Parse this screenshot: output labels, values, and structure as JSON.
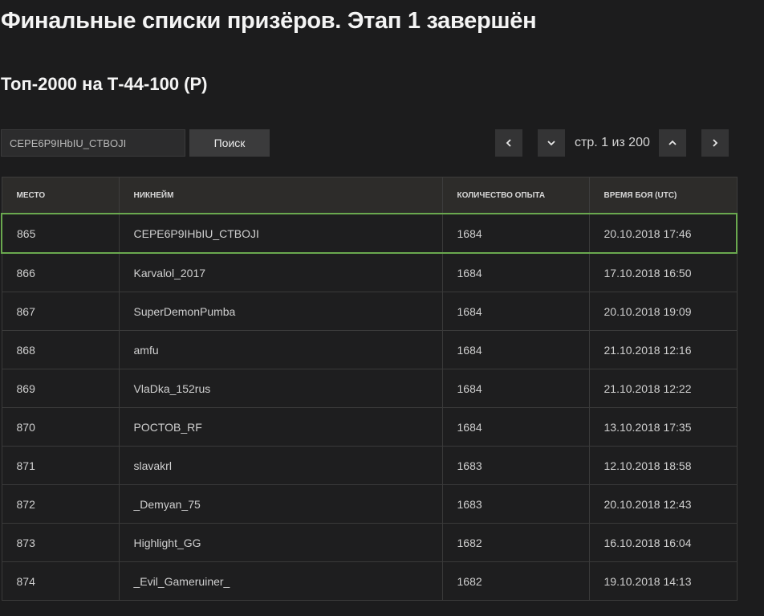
{
  "page": {
    "title": "Финальные списки призёров. Этап 1 завершён",
    "subtitle": "Топ-2000 на Т-44-100 (Р)"
  },
  "search": {
    "value": "CEPE6P9IHbIU_CTBOJI",
    "button_label": "Поиск"
  },
  "pagination": {
    "info": "стр. 1 из 200",
    "icons": [
      "chevron-left-icon",
      "chevron-down-icon",
      "chevron-up-icon",
      "chevron-right-icon"
    ]
  },
  "table": {
    "columns": [
      "Место",
      "Никнейм",
      "Количество опыта",
      "Время боя (UTC)"
    ],
    "highlight_color": "#6aa84f",
    "rows": [
      {
        "place": "865",
        "nickname": "CEPE6P9IHbIU_CTBOJI",
        "xp": "1684",
        "time": "20.10.2018 17:46"
      },
      {
        "place": "866",
        "nickname": "Karvalol_2017",
        "xp": "1684",
        "time": "17.10.2018 16:50"
      },
      {
        "place": "867",
        "nickname": "SuperDemonPumba",
        "xp": "1684",
        "time": "20.10.2018 19:09"
      },
      {
        "place": "868",
        "nickname": "amfu",
        "xp": "1684",
        "time": "21.10.2018 12:16"
      },
      {
        "place": "869",
        "nickname": "VlaDka_152rus",
        "xp": "1684",
        "time": "21.10.2018 12:22"
      },
      {
        "place": "870",
        "nickname": "POCTOB_RF",
        "xp": "1684",
        "time": "13.10.2018 17:35"
      },
      {
        "place": "871",
        "nickname": "slavakrl",
        "xp": "1683",
        "time": "12.10.2018 18:58"
      },
      {
        "place": "872",
        "nickname": "_Demyan_75",
        "xp": "1683",
        "time": "20.10.2018 12:43"
      },
      {
        "place": "873",
        "nickname": "Highlight_GG",
        "xp": "1682",
        "time": "16.10.2018 16:04"
      },
      {
        "place": "874",
        "nickname": "_Evil_Gameruiner_",
        "xp": "1682",
        "time": "19.10.2018 14:13"
      }
    ]
  }
}
